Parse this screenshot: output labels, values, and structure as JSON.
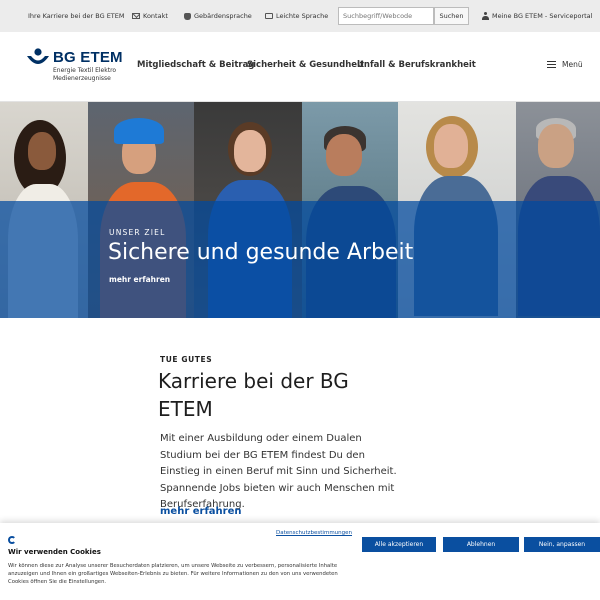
{
  "topbar": {
    "career": "Ihre Karriere bei der BG ETEM",
    "contact": "Kontakt",
    "sign_language": "Gebärdensprache",
    "easy_language": "Leichte Sprache",
    "search_placeholder": "Suchbegriff/Webcode",
    "search_button": "Suchen",
    "service_portal": "Meine BG ETEM - Serviceportal"
  },
  "header": {
    "logo_name": "BG ETEM",
    "logo_sub_1": "Energie Textil Elektro",
    "logo_sub_2": "Medienerzeugnisse",
    "nav": [
      "Mitgliedschaft & Beitrag",
      "Sicherheit & Gesundheit",
      "Unfall & Berufskrankheit"
    ],
    "menu": "Menü"
  },
  "hero": {
    "kicker": "UNSER ZIEL",
    "title": "Sichere und gesunde Arbeit",
    "link": "mehr erfahren"
  },
  "career": {
    "kicker": "TUE GUTES",
    "title": "Karriere bei der BG ETEM",
    "text": "Mit einer Ausbildung oder einem Dualen Studium bei der BG ETEM findest Du den Einstieg in einen Beruf mit Sinn und Sicherheit. Spannende Jobs bieten wir auch Menschen mit Berufserfahrung.",
    "link": "mehr erfahren"
  },
  "cookie": {
    "privacy_link": "Datenschutzbestimmungen",
    "title": "Wir verwenden Cookies",
    "text": "Wir können diese zur Analyse unserer Besucherdaten platzieren, um unsere Webseite zu verbessern, personalisierte Inhalte anzuzeigen und Ihnen ein großartiges Webseiten-Erlebnis zu bieten. Für weitere Informationen zu den von uns verwendeten Cookies öffnen Sie die Einstellungen.",
    "accept_all": "Alle akzeptieren",
    "reject": "Ablehnen",
    "customize": "Nein, anpassen"
  },
  "colors": {
    "brand_blue": "#0a4fa0",
    "logo_navy": "#003064",
    "hero_overlay": "#004aa0",
    "topbar_bg": "#ececec"
  }
}
